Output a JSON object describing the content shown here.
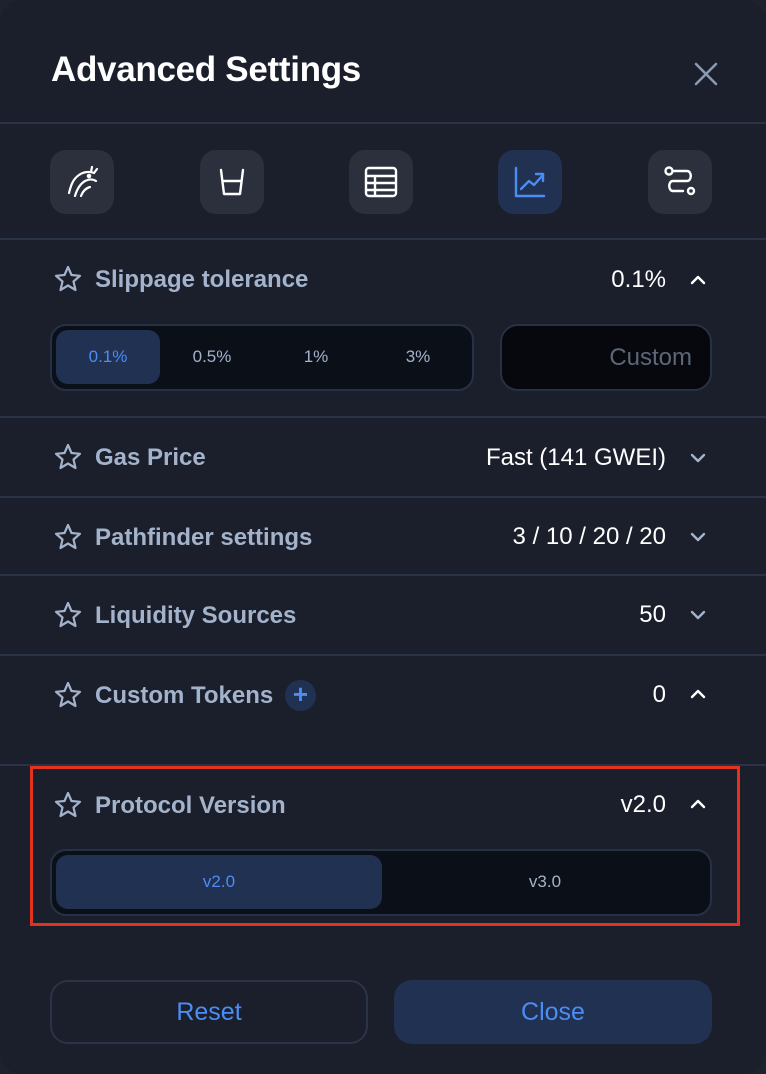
{
  "header": {
    "title": "Advanced Settings"
  },
  "toolbar": {
    "icons": [
      {
        "name": "dragon-icon",
        "active": false
      },
      {
        "name": "cup-icon",
        "active": false
      },
      {
        "name": "table-icon",
        "active": false
      },
      {
        "name": "chart-icon",
        "active": true
      },
      {
        "name": "route-icon",
        "active": false
      }
    ]
  },
  "slippage": {
    "label": "Slippage tolerance",
    "value": "0.1%",
    "options": [
      "0.1%",
      "0.5%",
      "1%",
      "3%"
    ],
    "selected": "0.1%",
    "custom_placeholder": "Custom"
  },
  "gas": {
    "label": "Gas Price",
    "value": "Fast (141 GWEI)"
  },
  "pathfinder": {
    "label": "Pathfinder settings",
    "value": "3 / 10 / 20 / 20"
  },
  "liquidity": {
    "label": "Liquidity Sources",
    "value": "50"
  },
  "custom_tokens": {
    "label": "Custom Tokens",
    "value": "0",
    "add_label": "+"
  },
  "protocol": {
    "label": "Protocol Version",
    "value": "v2.0",
    "options": [
      "v2.0",
      "v3.0"
    ],
    "selected": "v2.0"
  },
  "footer": {
    "reset_label": "Reset",
    "close_label": "Close"
  },
  "colors": {
    "accent": "#4c8cf5",
    "highlight_border": "#e3331f",
    "panel_bg": "#1b1f2b"
  }
}
